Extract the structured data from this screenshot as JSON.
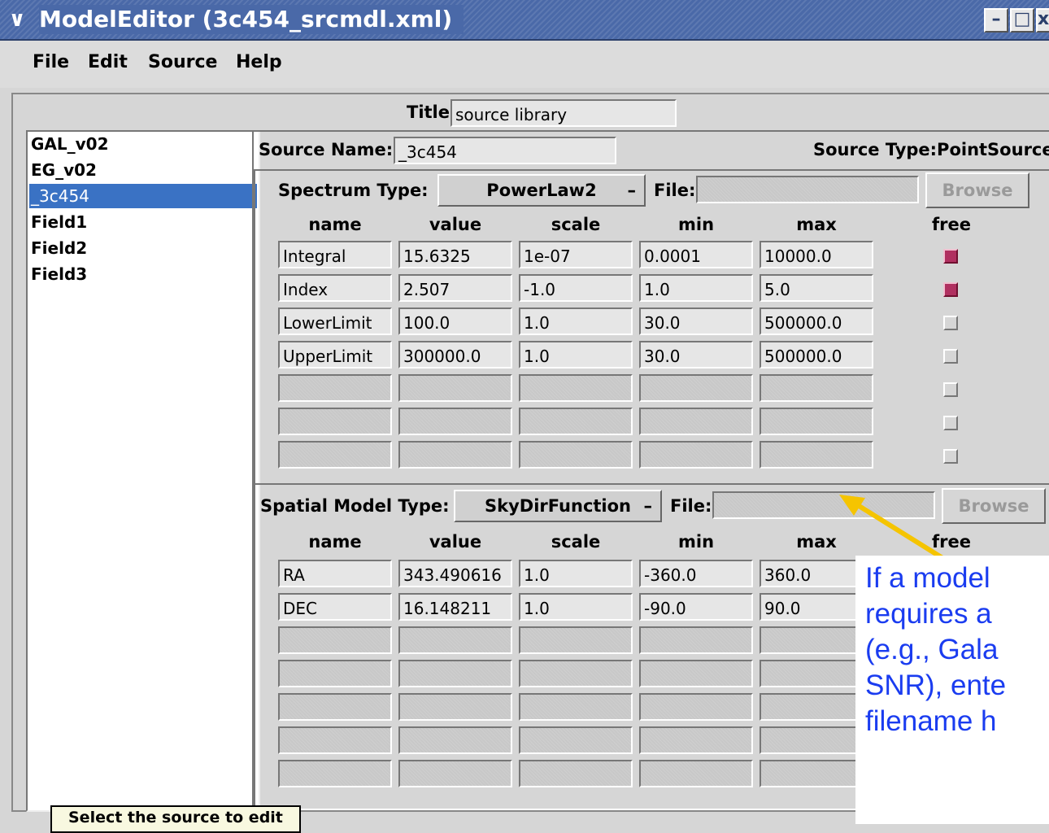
{
  "window": {
    "title": "ModelEditor (3c454_srcmdl.xml)",
    "menu_icon": "chevron-down-icon"
  },
  "menu": [
    "File",
    "Edit",
    "Source",
    "Help"
  ],
  "library": {
    "title_label": "Title",
    "title_value": "source library"
  },
  "sources": {
    "items": [
      "GAL_v02",
      "EG_v02",
      "_3c454",
      "Field1",
      "Field2",
      "Field3"
    ],
    "selected_index": 2
  },
  "source": {
    "name_label": "Source Name:",
    "name_value": "_3c454",
    "type_text": "Source Type:PointSource"
  },
  "spectrum": {
    "type_label": "Spectrum Type:",
    "type_value": "PowerLaw2",
    "file_label": "File:",
    "file_value": "",
    "browse_label": "Browse",
    "columns": [
      "name",
      "value",
      "scale",
      "min",
      "max",
      "free"
    ],
    "rows": [
      {
        "name": "Integral",
        "value": "15.6325",
        "scale": "1e-07",
        "min": "0.0001",
        "max": "10000.0",
        "free": true
      },
      {
        "name": "Index",
        "value": "2.507",
        "scale": "-1.0",
        "min": "1.0",
        "max": "5.0",
        "free": true
      },
      {
        "name": "LowerLimit",
        "value": "100.0",
        "scale": "1.0",
        "min": "30.0",
        "max": "500000.0",
        "free": false
      },
      {
        "name": "UpperLimit",
        "value": "300000.0",
        "scale": "1.0",
        "min": "30.0",
        "max": "500000.0",
        "free": false
      },
      {
        "name": "",
        "value": "",
        "scale": "",
        "min": "",
        "max": "",
        "free": false
      },
      {
        "name": "",
        "value": "",
        "scale": "",
        "min": "",
        "max": "",
        "free": false
      },
      {
        "name": "",
        "value": "",
        "scale": "",
        "min": "",
        "max": "",
        "free": false
      }
    ]
  },
  "spatial": {
    "type_label": "Spatial Model Type:",
    "type_value": "SkyDirFunction",
    "file_label": "File:",
    "file_value": "",
    "browse_label": "Browse",
    "columns": [
      "name",
      "value",
      "scale",
      "min",
      "max",
      "free"
    ],
    "rows": [
      {
        "name": "RA",
        "value": "343.490616",
        "scale": "1.0",
        "min": "-360.0",
        "max": "360.0"
      },
      {
        "name": "DEC",
        "value": "16.148211",
        "scale": "1.0",
        "min": "-90.0",
        "max": "90.0"
      },
      {
        "name": "",
        "value": "",
        "scale": "",
        "min": "",
        "max": ""
      },
      {
        "name": "",
        "value": "",
        "scale": "",
        "min": "",
        "max": ""
      },
      {
        "name": "",
        "value": "",
        "scale": "",
        "min": "",
        "max": ""
      },
      {
        "name": "",
        "value": "",
        "scale": "",
        "min": "",
        "max": ""
      },
      {
        "name": "",
        "value": "",
        "scale": "",
        "min": "",
        "max": ""
      }
    ]
  },
  "status_text": "Select the source to edit",
  "annotation": {
    "text": "If a model\nrequires a\n(e.g., Gala\nSNR), ente\nfilename h",
    "color": "#1a3cf0",
    "arrow_color": "#f5c400"
  }
}
